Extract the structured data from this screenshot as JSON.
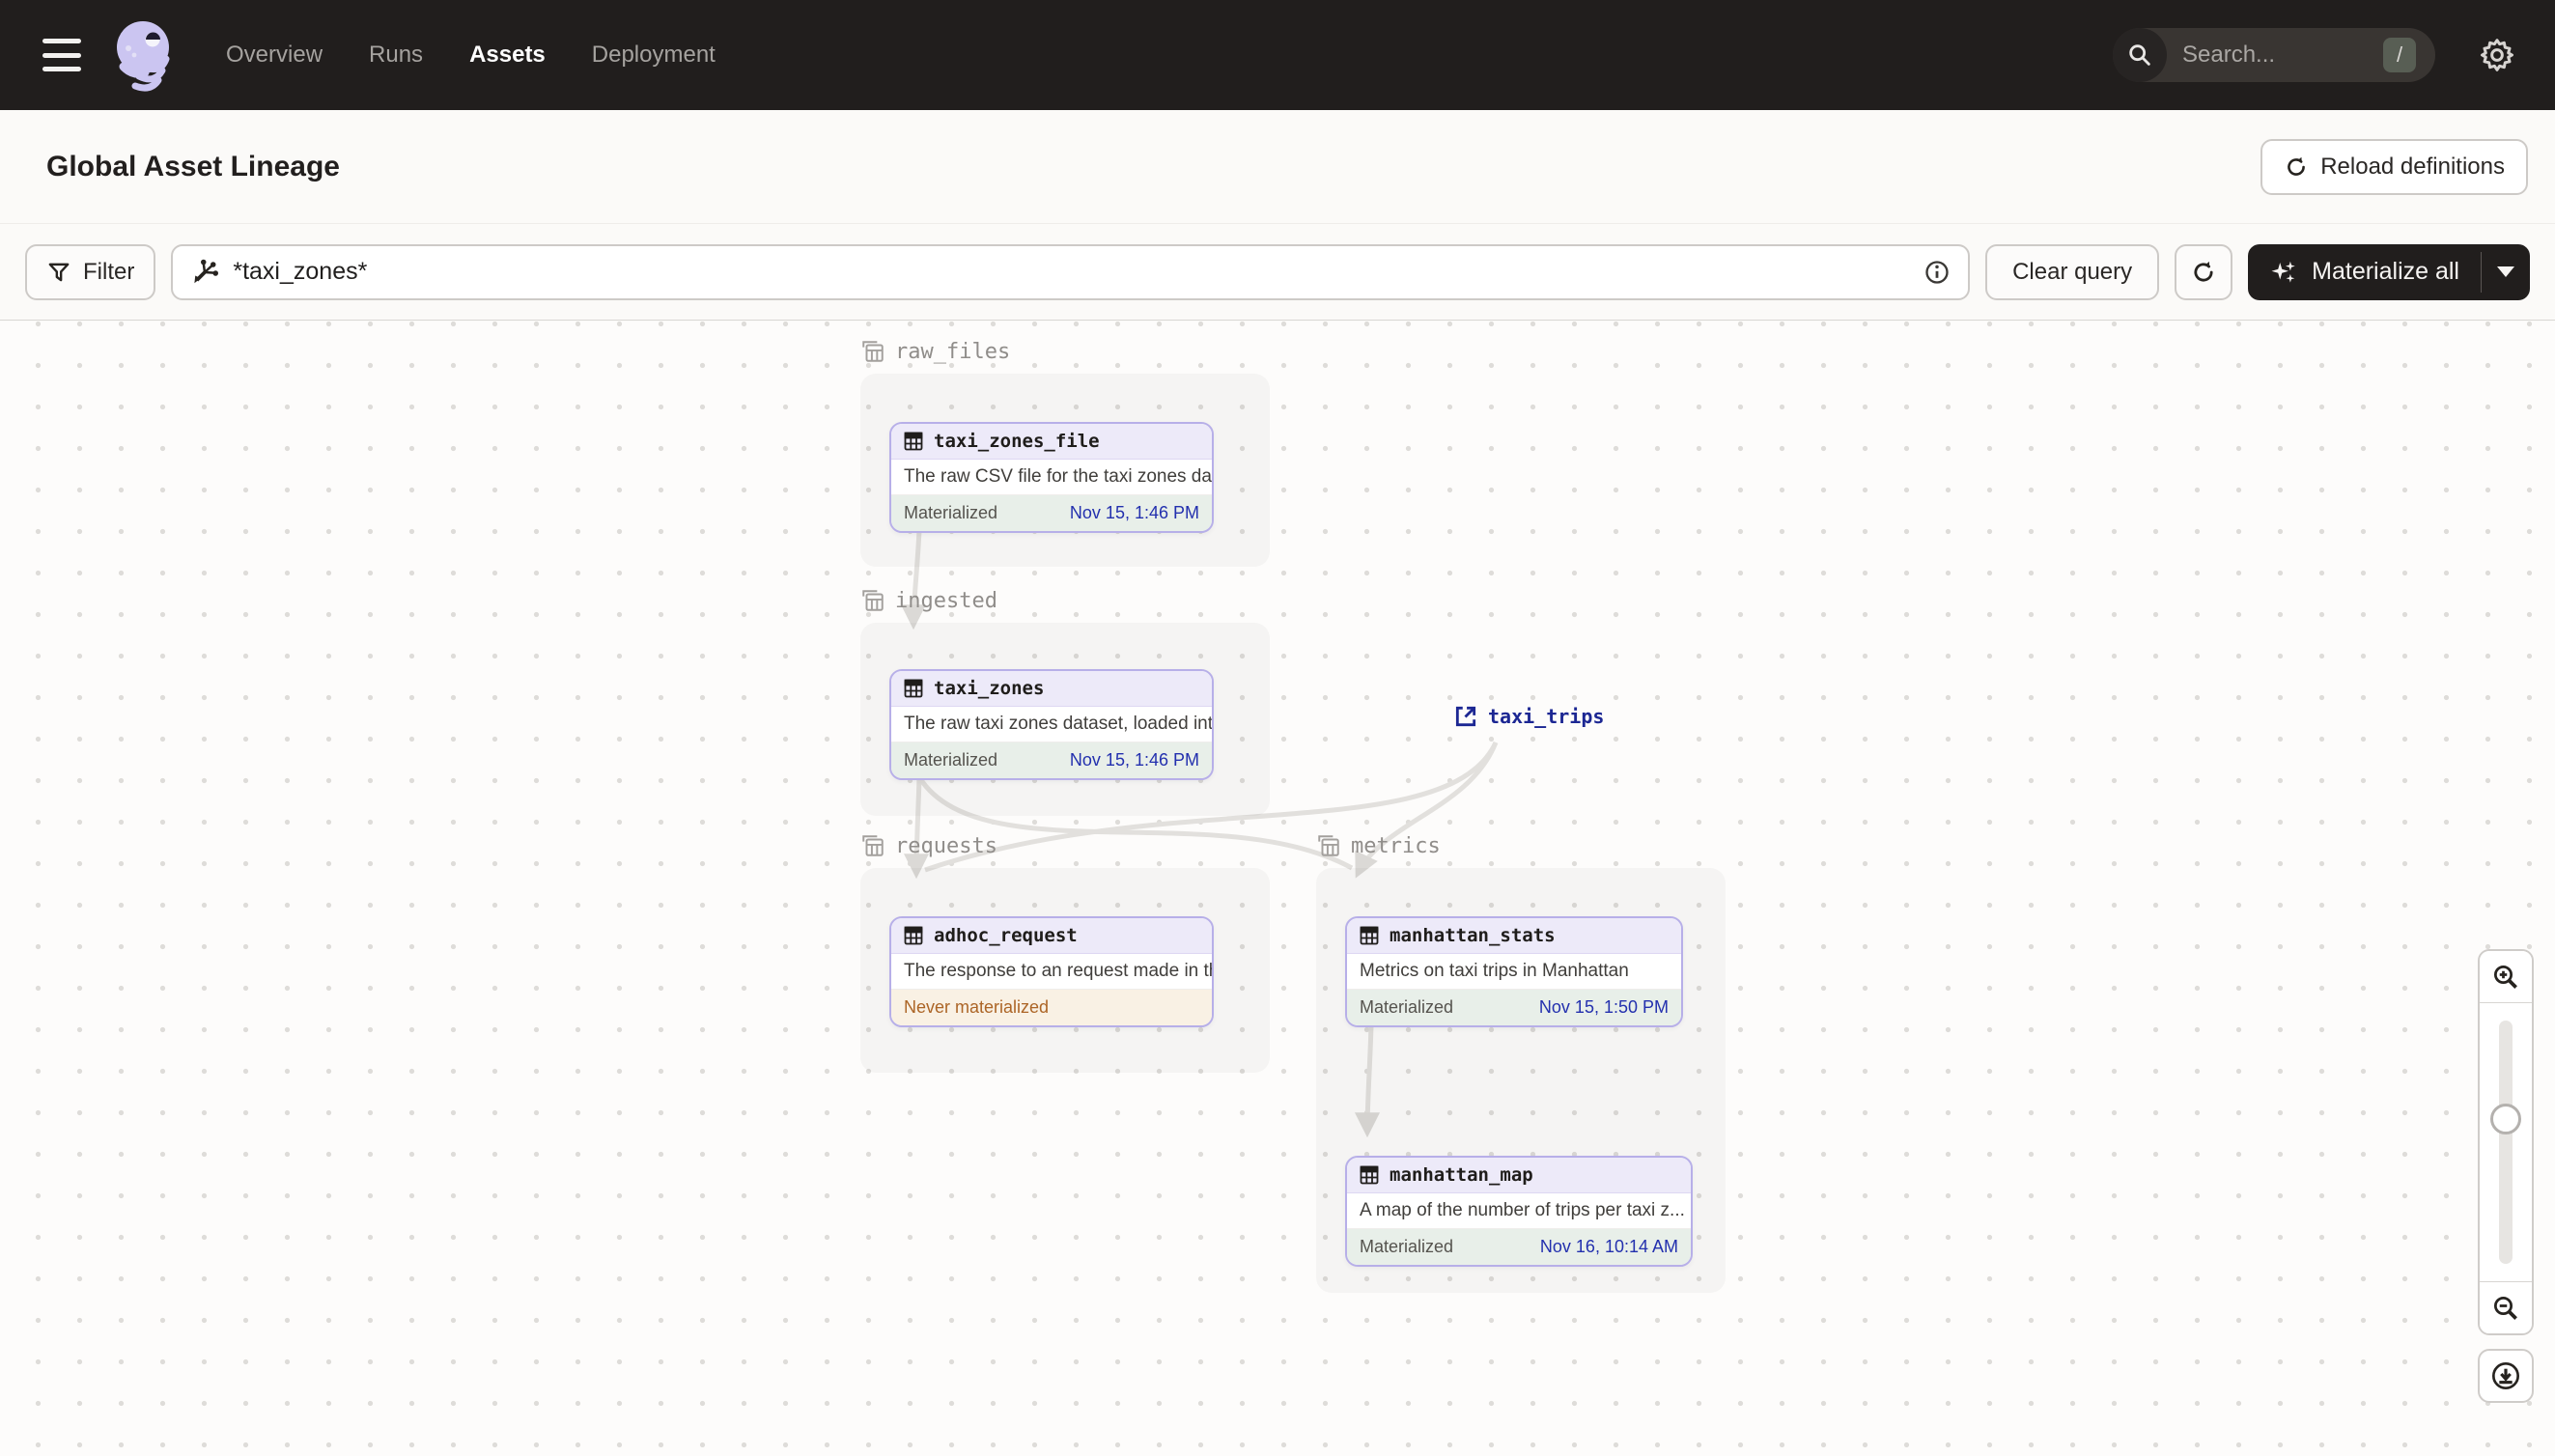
{
  "nav": {
    "items": [
      {
        "label": "Overview",
        "active": false
      },
      {
        "label": "Runs",
        "active": false
      },
      {
        "label": "Assets",
        "active": true
      },
      {
        "label": "Deployment",
        "active": false
      }
    ],
    "search": {
      "placeholder": "Search...",
      "shortcut": "/"
    }
  },
  "header": {
    "title": "Global Asset Lineage",
    "reload_button": "Reload definitions"
  },
  "toolbar": {
    "filter_label": "Filter",
    "query_value": "*taxi_zones*",
    "clear_button": "Clear query",
    "materialize_button": "Materialize all"
  },
  "graph": {
    "groups": [
      {
        "name": "raw_files"
      },
      {
        "name": "ingested"
      },
      {
        "name": "requests"
      },
      {
        "name": "metrics"
      }
    ],
    "nodes": [
      {
        "name": "taxi_zones_file",
        "description": "The raw CSV file for the taxi zones dat...",
        "status": "Materialized",
        "timestamp": "Nov 15, 1:46 PM"
      },
      {
        "name": "taxi_zones",
        "description": "The raw taxi zones dataset, loaded int...",
        "status": "Materialized",
        "timestamp": "Nov 15, 1:46 PM"
      },
      {
        "name": "adhoc_request",
        "description": "The response to an request made in th...",
        "status": "Never materialized",
        "timestamp": ""
      },
      {
        "name": "manhattan_stats",
        "description": "Metrics on taxi trips in Manhattan",
        "status": "Materialized",
        "timestamp": "Nov 15, 1:50 PM"
      },
      {
        "name": "manhattan_map",
        "description": "A map of the number of trips per taxi z...",
        "status": "Materialized",
        "timestamp": "Nov 16, 10:14 AM"
      }
    ],
    "external_assets": [
      {
        "name": "taxi_trips"
      }
    ]
  },
  "colors": {
    "topbar_bg": "#211e1d",
    "accent_lavender": "#b7afe8",
    "node_header_bg": "#edeaf9",
    "materialized_bg": "#e8efe9",
    "materialized_time": "#2330ae",
    "never_materialized_bg": "#f9f1e4",
    "never_materialized_text": "#ac6526",
    "external_link": "#1c2793",
    "edge": "#e2e0dd"
  }
}
